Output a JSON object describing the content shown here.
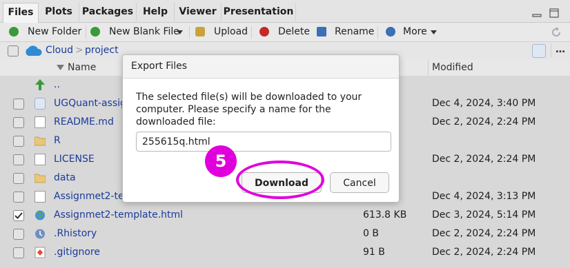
{
  "tabs": [
    {
      "label": "Files",
      "active": true
    },
    {
      "label": "Plots",
      "active": false
    },
    {
      "label": "Packages",
      "active": false
    },
    {
      "label": "Help",
      "active": false
    },
    {
      "label": "Viewer",
      "active": false
    },
    {
      "label": "Presentation",
      "active": false
    }
  ],
  "toolbar": {
    "new_folder": "New Folder",
    "new_blank_file": "New Blank File",
    "upload": "Upload",
    "delete": "Delete",
    "rename": "Rename",
    "more": "More"
  },
  "path": {
    "root": "Cloud",
    "separator": ">",
    "folder": "project"
  },
  "columns": {
    "name": "Name",
    "modified": "Modified"
  },
  "files": [
    {
      "name": "..",
      "size": "",
      "modified": "",
      "icon": "up-arrow-icon",
      "checkbox": false,
      "checked": false
    },
    {
      "name": "UGQuant-assig",
      "size": "",
      "modified": "Dec 4, 2024, 3:40 PM",
      "icon": "rproj-file-icon",
      "checkbox": true,
      "checked": false
    },
    {
      "name": "README.md",
      "size": "",
      "modified": "Dec 2, 2024, 2:24 PM",
      "icon": "markdown-file-icon",
      "checkbox": true,
      "checked": false
    },
    {
      "name": "R",
      "size": "",
      "modified": "",
      "icon": "folder-icon",
      "checkbox": true,
      "checked": false
    },
    {
      "name": "LICENSE",
      "size": "",
      "modified": "Dec 2, 2024, 2:24 PM",
      "icon": "text-file-icon",
      "checkbox": true,
      "checked": false
    },
    {
      "name": "data",
      "size": "",
      "modified": "",
      "icon": "folder-icon",
      "checkbox": true,
      "checked": false
    },
    {
      "name": "Assignmet2-te",
      "size": "",
      "modified": "Dec 4, 2024, 3:13 PM",
      "icon": "rmd-file-icon",
      "checkbox": true,
      "checked": false
    },
    {
      "name": "Assignmet2-template.html",
      "size": "613.8 KB",
      "modified": "Dec 3, 2024, 5:14 PM",
      "icon": "html-file-icon",
      "checkbox": true,
      "checked": true
    },
    {
      "name": ".Rhistory",
      "size": "0 B",
      "modified": "Dec 2, 2024, 2:24 PM",
      "icon": "rhistory-file-icon",
      "checkbox": true,
      "checked": false
    },
    {
      "name": ".gitignore",
      "size": "91 B",
      "modified": "Dec 2, 2024, 2:24 PM",
      "icon": "git-file-icon",
      "checkbox": true,
      "checked": false
    }
  ],
  "dialog": {
    "title": "Export Files",
    "message": "The selected file(s) will be downloaded to your computer. Please specify a name for the downloaded file:",
    "filename": "255615q.html",
    "download_label": "Download",
    "cancel_label": "Cancel"
  },
  "annotation": {
    "step": "5",
    "color": "#e000dc"
  }
}
